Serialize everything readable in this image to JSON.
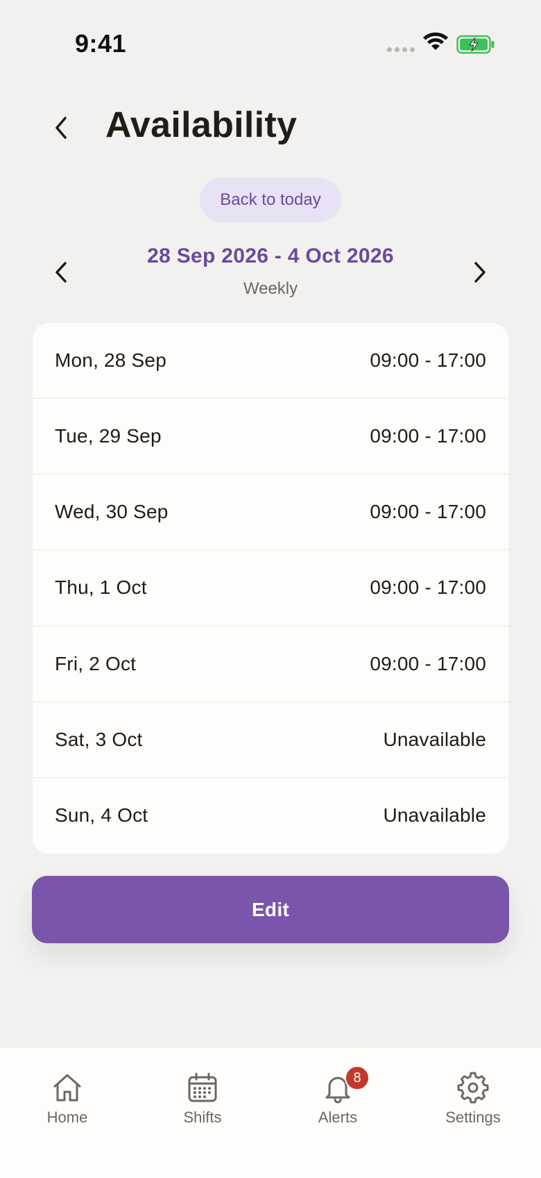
{
  "status_bar": {
    "time": "9:41"
  },
  "header": {
    "title": "Availability"
  },
  "today_button": {
    "label": "Back to today"
  },
  "range": {
    "label": "28 Sep 2026 - 4 Oct 2026",
    "period": "Weekly"
  },
  "days": [
    {
      "day": "Mon, 28 Sep",
      "hours": "09:00 - 17:00"
    },
    {
      "day": "Tue, 29 Sep",
      "hours": "09:00 - 17:00"
    },
    {
      "day": "Wed, 30 Sep",
      "hours": "09:00 - 17:00"
    },
    {
      "day": "Thu, 1 Oct",
      "hours": "09:00 - 17:00"
    },
    {
      "day": "Fri, 2 Oct",
      "hours": "09:00 - 17:00"
    },
    {
      "day": "Sat, 3 Oct",
      "hours": "Unavailable"
    },
    {
      "day": "Sun, 4 Oct",
      "hours": "Unavailable"
    }
  ],
  "edit_button": {
    "label": "Edit"
  },
  "nav": {
    "home": {
      "label": "Home",
      "icon": "home-icon"
    },
    "shifts": {
      "label": "Shifts",
      "icon": "calendar-icon"
    },
    "alerts": {
      "label": "Alerts",
      "icon": "bell-icon",
      "badge": "8"
    },
    "settings": {
      "label": "Settings",
      "icon": "gear-icon"
    }
  },
  "colors": {
    "accent": "#7b55ab",
    "accent_text": "#6a4a9c",
    "pill_bg": "#e8e2f5",
    "background": "#f2f1ef",
    "card": "#fefdfb",
    "badge": "#c0392b",
    "battery": "#3fbf5a"
  }
}
